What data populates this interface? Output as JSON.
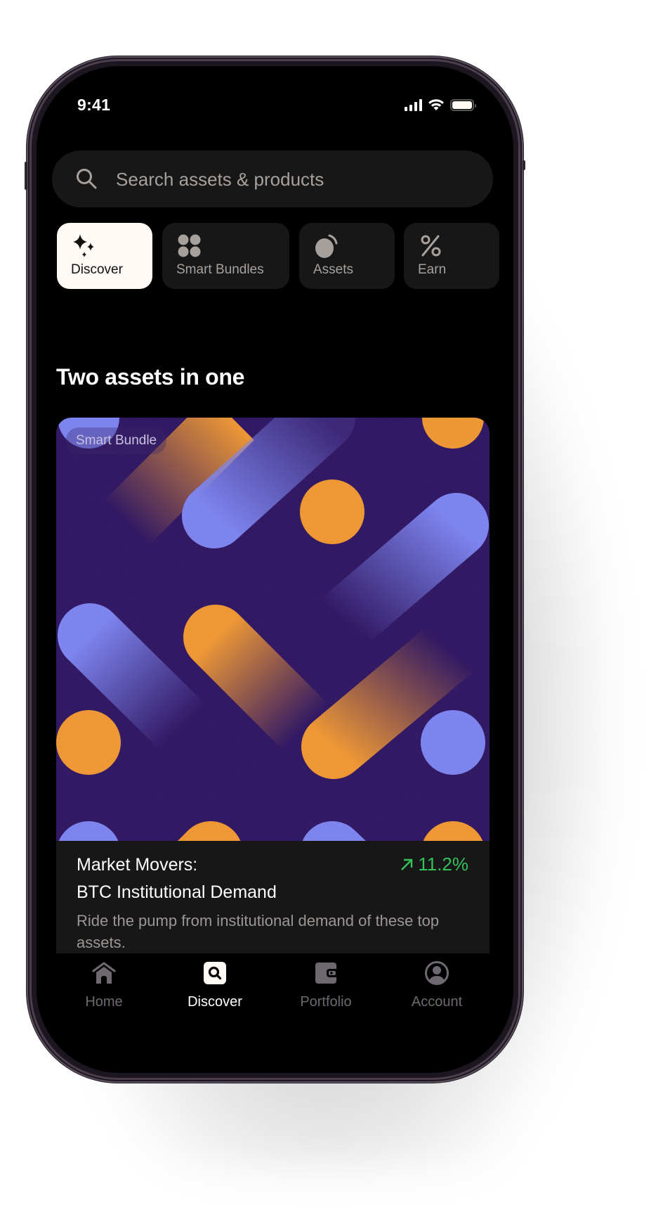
{
  "status_bar": {
    "time": "9:41",
    "icons": [
      "signal-icon",
      "wifi-icon",
      "battery-icon"
    ]
  },
  "search": {
    "placeholder": "Search assets & products",
    "icon": "search-icon"
  },
  "categories": [
    {
      "label": "Discover",
      "icon": "sparkles-icon",
      "active": true
    },
    {
      "label": "Smart Bundles",
      "icon": "bundle-dots-icon",
      "active": false
    },
    {
      "label": "Assets",
      "icon": "coin-icon",
      "active": false
    },
    {
      "label": "Earn",
      "icon": "percent-icon",
      "active": false
    }
  ],
  "section": {
    "title": "Two assets in one"
  },
  "card": {
    "badge": "Smart Bundle",
    "kicker": "Market Movers:",
    "name": "BTC Institutional Demand",
    "change": "11.2%",
    "change_direction": "up",
    "description": "Ride the pump from institutional demand of these top assets.",
    "colors": {
      "background": "#2c1260",
      "orange": "#f0962f",
      "periwinkle": "#7a82f0",
      "positive": "#33c25a"
    }
  },
  "bottom_nav": [
    {
      "label": "Home",
      "icon": "home-icon",
      "active": false
    },
    {
      "label": "Discover",
      "icon": "discover-search-icon",
      "active": true
    },
    {
      "label": "Portfolio",
      "icon": "wallet-icon",
      "active": false
    },
    {
      "label": "Account",
      "icon": "account-icon",
      "active": false
    }
  ]
}
